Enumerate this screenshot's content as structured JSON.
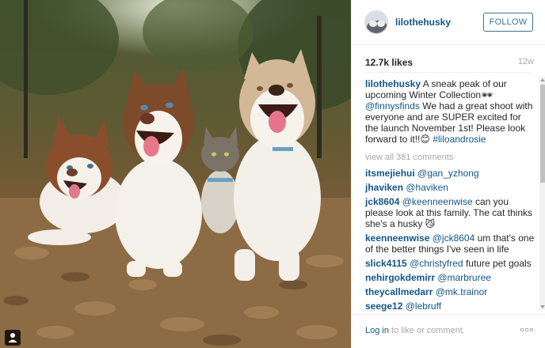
{
  "post": {
    "username": "lilothehusky",
    "follow_label": "FOLLOW",
    "likes": "12.7k likes",
    "age": "12w"
  },
  "caption": {
    "username": "lilothehusky",
    "text_1": "A sneak peak of our upcoming Winter Collection🕶",
    "mention": "@finnysfinds",
    "text_2": "We had a great shoot with everyone and are SUPER excited for the launch November 1st! Please look forward to it!!😊",
    "hashtag": "#liloandrosie"
  },
  "view_all": "view all 381 comments",
  "comments": [
    {
      "user": "itsmejiehui",
      "mention": "@gan_yzhong",
      "text": ""
    },
    {
      "user": "jhaviken",
      "mention": "@haviken",
      "text": ""
    },
    {
      "user": "jck8604",
      "mention": "@keenneenwise",
      "text": "can you please look at this family. The cat thinks she's a husky 😼"
    },
    {
      "user": "keenneenwise",
      "mention": "@jck8604",
      "text": "um that's one of the better things I've seen in life"
    },
    {
      "user": "slick4115",
      "mention": "@christyfred",
      "text": "future pet goals"
    },
    {
      "user": "nehirgokdemirr",
      "mention": "@marbruree",
      "text": ""
    },
    {
      "user": "theycallmedarr",
      "mention": "@mk.trainor",
      "text": ""
    },
    {
      "user": "seege12",
      "mention": "@lebruff",
      "text": ""
    }
  ],
  "footer": {
    "login_link": "Log in",
    "login_rest": " to like or comment."
  },
  "icons": {
    "user_tag": "person-icon",
    "more": "more-options-icon"
  }
}
